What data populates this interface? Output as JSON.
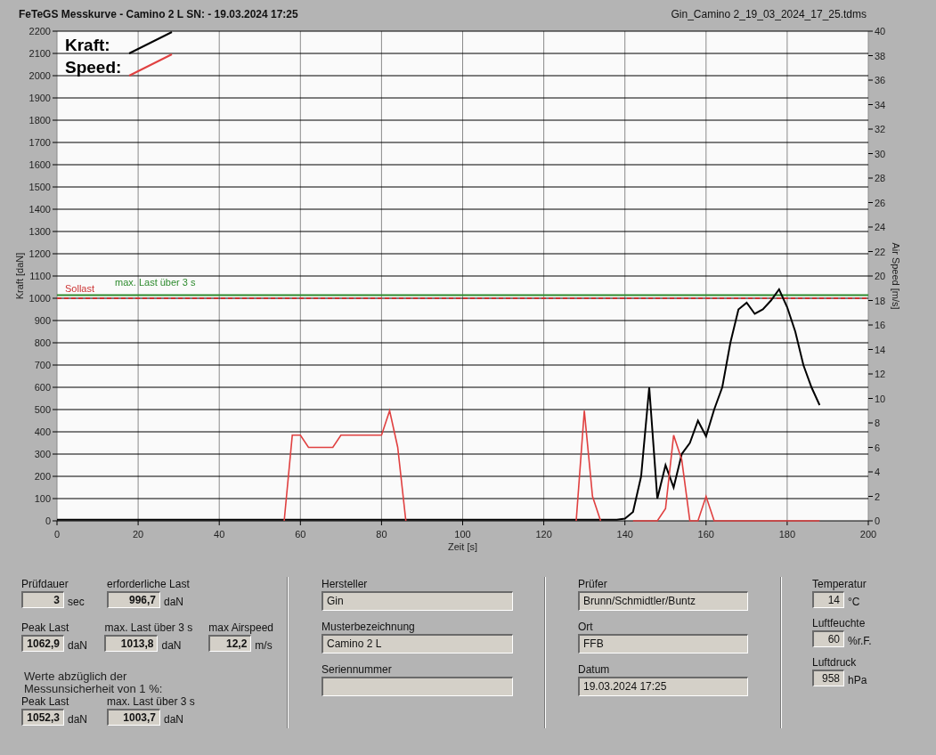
{
  "header": {
    "title": "FeTeGS Messkurve - Camino 2 L  SN:  - 19.03.2024 17:25",
    "file": "Gin_Camino 2_19_03_2024_17_25.tdms"
  },
  "chart": {
    "chart_data": {
      "type": "line",
      "xlabel": "Zeit [s]",
      "ylabel": "Kraft [daN]",
      "y2label": "Air Speed [m/s]",
      "x": [
        0,
        2,
        4,
        6,
        8,
        10,
        12,
        14,
        16,
        18,
        20,
        22,
        24,
        26,
        28,
        30,
        32,
        34,
        36,
        38,
        40,
        42,
        44,
        46,
        48,
        50,
        52,
        54,
        56,
        58,
        60,
        62,
        64,
        66,
        68,
        70,
        72,
        74,
        76,
        78,
        80,
        82,
        84,
        86,
        88,
        90,
        92,
        94,
        96,
        98,
        100,
        102,
        104,
        106,
        108,
        110,
        112,
        114,
        116,
        118,
        120,
        122,
        124,
        126,
        128,
        130,
        132,
        134,
        136,
        138,
        140,
        142,
        144,
        146,
        148,
        150,
        152,
        154,
        156,
        158,
        160,
        162,
        164,
        166,
        168,
        170,
        172,
        174,
        176,
        178,
        180,
        182,
        184,
        186,
        188
      ],
      "series": [
        {
          "name": "Kraft:",
          "color": "#000000",
          "values": [
            5,
            5,
            5,
            5,
            5,
            5,
            5,
            5,
            5,
            5,
            5,
            5,
            5,
            5,
            5,
            5,
            5,
            5,
            5,
            5,
            5,
            5,
            5,
            5,
            5,
            5,
            5,
            5,
            5,
            5,
            5,
            5,
            5,
            5,
            5,
            5,
            5,
            5,
            5,
            5,
            5,
            5,
            5,
            5,
            5,
            5,
            5,
            5,
            5,
            5,
            5,
            5,
            5,
            5,
            5,
            5,
            5,
            5,
            5,
            5,
            5,
            5,
            5,
            5,
            5,
            5,
            5,
            5,
            5,
            5,
            10,
            40,
            200,
            600,
            100,
            250,
            150,
            300,
            350,
            450,
            380,
            500,
            600,
            800,
            950,
            980,
            930,
            950,
            990,
            1040,
            960,
            850,
            700,
            600,
            520
          ]
        },
        {
          "name": "Speed:",
          "color": "#e04040",
          "axis": "y2",
          "values": [
            null,
            null,
            null,
            null,
            null,
            null,
            null,
            null,
            null,
            null,
            null,
            null,
            null,
            null,
            null,
            null,
            null,
            null,
            null,
            null,
            null,
            null,
            null,
            null,
            null,
            null,
            null,
            null,
            0,
            7,
            7,
            6,
            6,
            6,
            6,
            7,
            7,
            7,
            7,
            7,
            7,
            9,
            6,
            0,
            null,
            null,
            null,
            null,
            null,
            null,
            null,
            null,
            null,
            null,
            null,
            null,
            null,
            null,
            null,
            null,
            null,
            null,
            null,
            null,
            0,
            9,
            2,
            0,
            null,
            null,
            null,
            0,
            0,
            0,
            0,
            1,
            7,
            5,
            0,
            0,
            2,
            0,
            0,
            0,
            0,
            0,
            0,
            0,
            0,
            0,
            0,
            0,
            0,
            0,
            0
          ]
        }
      ],
      "grid": true,
      "legend": true,
      "ref_lines": [
        {
          "axis": "y",
          "value": 1000,
          "label": "Sollast",
          "color": "#cc3333"
        },
        {
          "axis": "y",
          "value": 1014,
          "label": "max. Last über  3 s",
          "color": "#2e8b2e"
        }
      ],
      "xlim": [
        0,
        200
      ],
      "ylim": [
        0,
        2200
      ],
      "y2lim": [
        0,
        40
      ],
      "xticks": [
        0,
        20,
        40,
        60,
        80,
        100,
        120,
        140,
        160,
        180,
        200
      ],
      "yticks": [
        0,
        100,
        200,
        300,
        400,
        500,
        600,
        700,
        800,
        900,
        1000,
        1100,
        1200,
        1300,
        1400,
        1500,
        1600,
        1700,
        1800,
        1900,
        2000,
        2100,
        2200
      ],
      "y2ticks": [
        0,
        2,
        4,
        6,
        8,
        10,
        12,
        14,
        16,
        18,
        20,
        22,
        24,
        26,
        28,
        30,
        32,
        34,
        36,
        38,
        40
      ]
    }
  },
  "results": {
    "pruefdauer": {
      "label": "Prüfdauer",
      "value": "3",
      "unit": "sec"
    },
    "erforderliche_last": {
      "label": "erforderliche Last",
      "value": "996,7",
      "unit": "daN"
    },
    "peak_last": {
      "label": "Peak Last",
      "value": "1062,9",
      "unit": "daN"
    },
    "max_last": {
      "label": "max. Last über  3 s",
      "value": "1013,8",
      "unit": "daN"
    },
    "max_airspeed": {
      "label": "max Airspeed",
      "value": "12,2",
      "unit": "m/s"
    },
    "note": [
      "Werte abzüglich der",
      "Messunsicherheit von 1  %:"
    ],
    "corrected_peak": {
      "label": "Peak Last",
      "value": "1052,3",
      "unit": "daN"
    },
    "corrected_max": {
      "label": "max. Last über  3 s",
      "value": "1003,7",
      "unit": "daN"
    }
  },
  "sample": [
    {
      "label": "Hersteller",
      "value": "Gin"
    },
    {
      "label": "Musterbezeichnung",
      "value": "Camino 2 L"
    },
    {
      "label": "Seriennummer"
    }
  ],
  "test": [
    {
      "label": "Prüfer",
      "value": "Brunn/Schmidtler/Buntz"
    },
    {
      "label": "Ort",
      "value": "FFB"
    },
    {
      "label": "Datum",
      "value": "19.03.2024 17:25"
    }
  ],
  "environment": [
    {
      "label": "Temperatur",
      "value": "14",
      "unit": "°C"
    },
    {
      "label": "Luftfeuchte",
      "value": "60",
      "unit": "%r.F."
    },
    {
      "label": "Luftdruck",
      "value": "958",
      "unit": "hPa"
    }
  ]
}
